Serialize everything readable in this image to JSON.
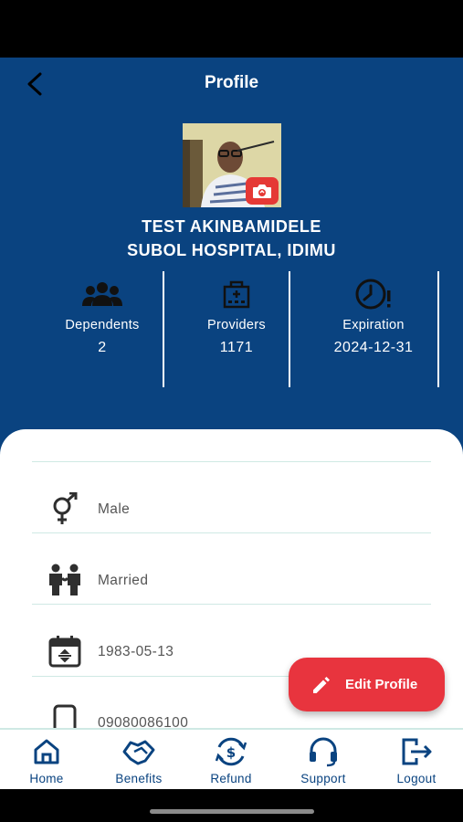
{
  "header": {
    "title": "Profile"
  },
  "profile": {
    "name": "TEST AKINBAMIDELE",
    "hospital": "SUBOL HOSPITAL, IDIMU"
  },
  "stats": {
    "dependents": {
      "label": "Dependents",
      "value": "2",
      "icon": "people-icon"
    },
    "providers": {
      "label": "Providers",
      "value": "1171",
      "icon": "hospital-icon"
    },
    "expiration": {
      "label": "Expiration",
      "value": "2024-12-31",
      "icon": "clock-alert-icon"
    }
  },
  "details": {
    "gender": {
      "value": "Male",
      "icon": "gender-icon"
    },
    "marital_status": {
      "value": "Married",
      "icon": "couple-icon"
    },
    "dob": {
      "value": "1983-05-13",
      "icon": "calendar-icon"
    },
    "phone": {
      "value": "09080086100",
      "icon": "phone-icon"
    }
  },
  "edit_button": {
    "label": "Edit Profile",
    "icon": "pencil-icon"
  },
  "nav": {
    "items": [
      {
        "label": "Home",
        "icon": "home-icon"
      },
      {
        "label": "Benefits",
        "icon": "handshake-icon"
      },
      {
        "label": "Refund",
        "icon": "refund-icon"
      },
      {
        "label": "Support",
        "icon": "headset-icon"
      },
      {
        "label": "Logout",
        "icon": "logout-icon"
      }
    ]
  },
  "colors": {
    "primary": "#0a4380",
    "accent": "#e8343e",
    "divider": "#cfe9e4",
    "icon_dark": "#2f2f2f"
  }
}
